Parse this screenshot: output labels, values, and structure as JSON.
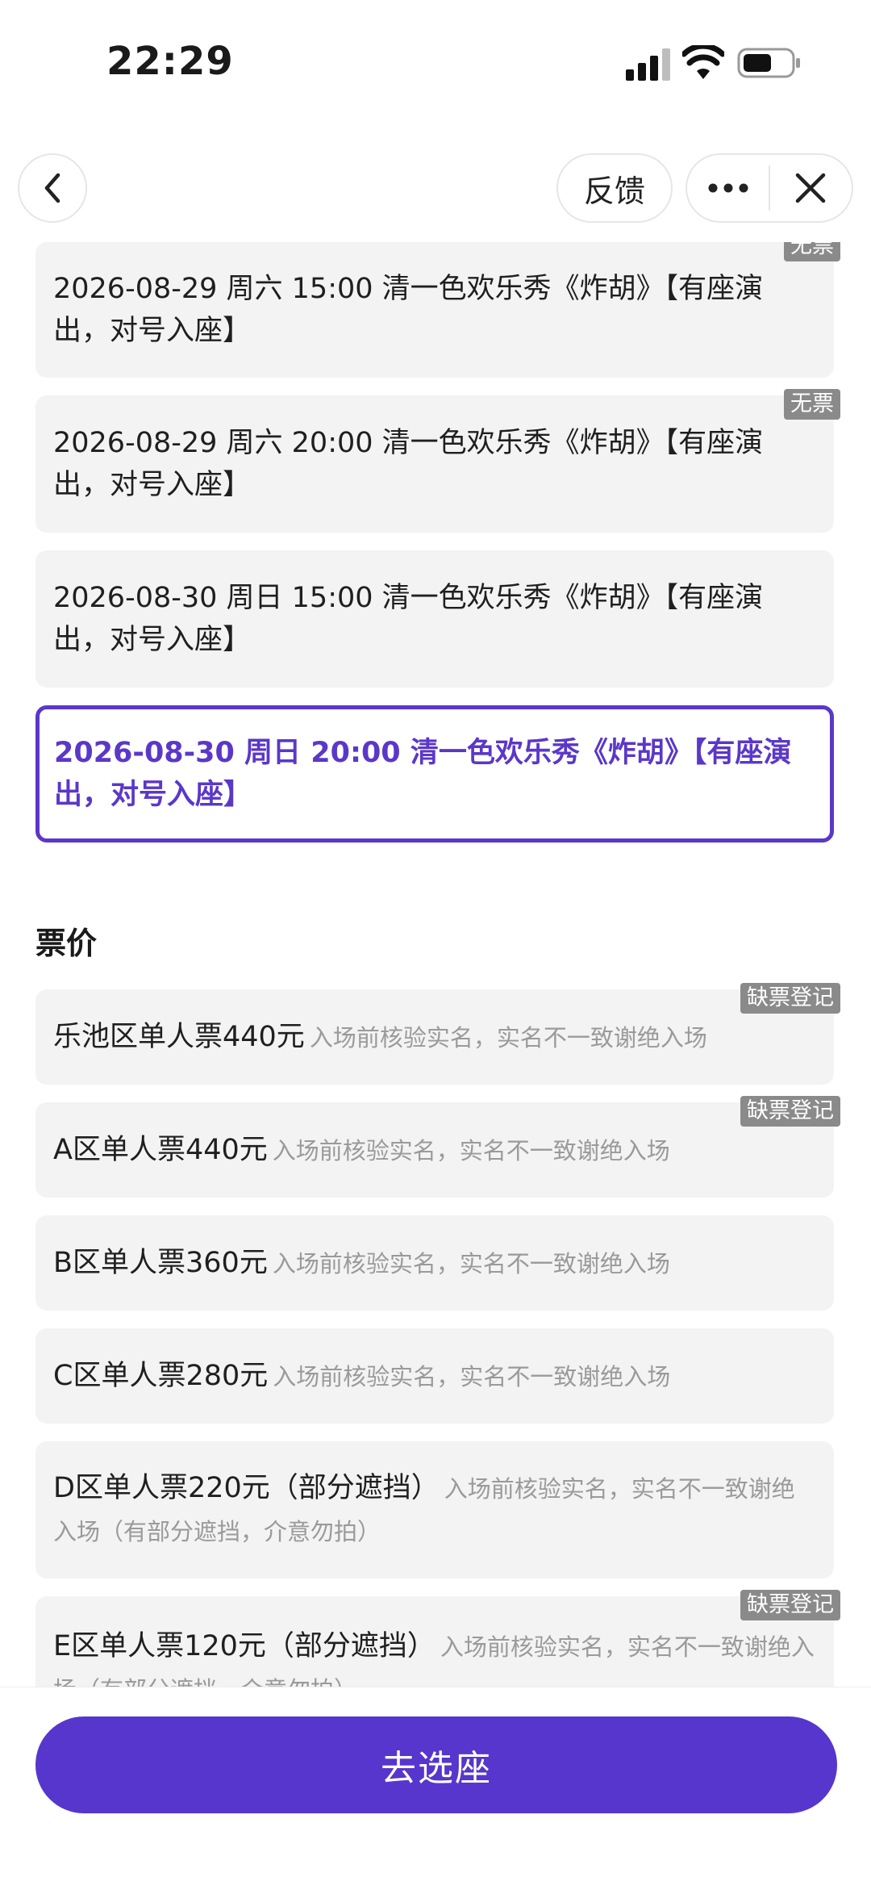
{
  "status_bar": {
    "time": "22:29"
  },
  "nav": {
    "feedback_label": "反馈"
  },
  "sessions": [
    {
      "text": "2026-08-29 周六 15:00 清一色欢乐秀《炸胡》【有座演出，对号入座】",
      "badge": "无票"
    },
    {
      "text": "2026-08-29 周六 20:00 清一色欢乐秀《炸胡》【有座演出，对号入座】",
      "badge": "无票"
    },
    {
      "text": "2026-08-30 周日 15:00 清一色欢乐秀《炸胡》【有座演出，对号入座】",
      "badge": ""
    },
    {
      "text": "2026-08-30 周日 20:00 清一色欢乐秀《炸胡》【有座演出，对号入座】",
      "badge": "",
      "selected": true
    }
  ],
  "price_section": {
    "title": "票价"
  },
  "prices": [
    {
      "name": "乐池区单人票440元",
      "note": "入场前核验实名，实名不一致谢绝入场",
      "badge": "缺票登记"
    },
    {
      "name": "A区单人票440元",
      "note": "入场前核验实名，实名不一致谢绝入场",
      "badge": "缺票登记"
    },
    {
      "name": "B区单人票360元",
      "note": "入场前核验实名，实名不一致谢绝入场",
      "badge": ""
    },
    {
      "name": "C区单人票280元",
      "note": "入场前核验实名，实名不一致谢绝入场",
      "badge": ""
    },
    {
      "name": "D区单人票220元（部分遮挡）",
      "note": "入场前核验实名，实名不一致谢绝入场（有部分遮挡，介意勿拍）",
      "badge": ""
    },
    {
      "name": "E区单人票120元（部分遮挡）",
      "note": "入场前核验实名，实名不一致谢绝入场（有部分遮挡，介意勿拍）",
      "badge": "缺票登记"
    }
  ],
  "bottom": {
    "button_label": "去选座"
  },
  "colors": {
    "accent": "#5636cc",
    "selected_text": "#5b37c9",
    "card_bg": "#f3f3f3",
    "badge_bg": "#8a8a8a"
  },
  "icons": [
    "back-icon",
    "more-icon",
    "close-icon",
    "signal-icon",
    "wifi-icon",
    "battery-icon"
  ]
}
